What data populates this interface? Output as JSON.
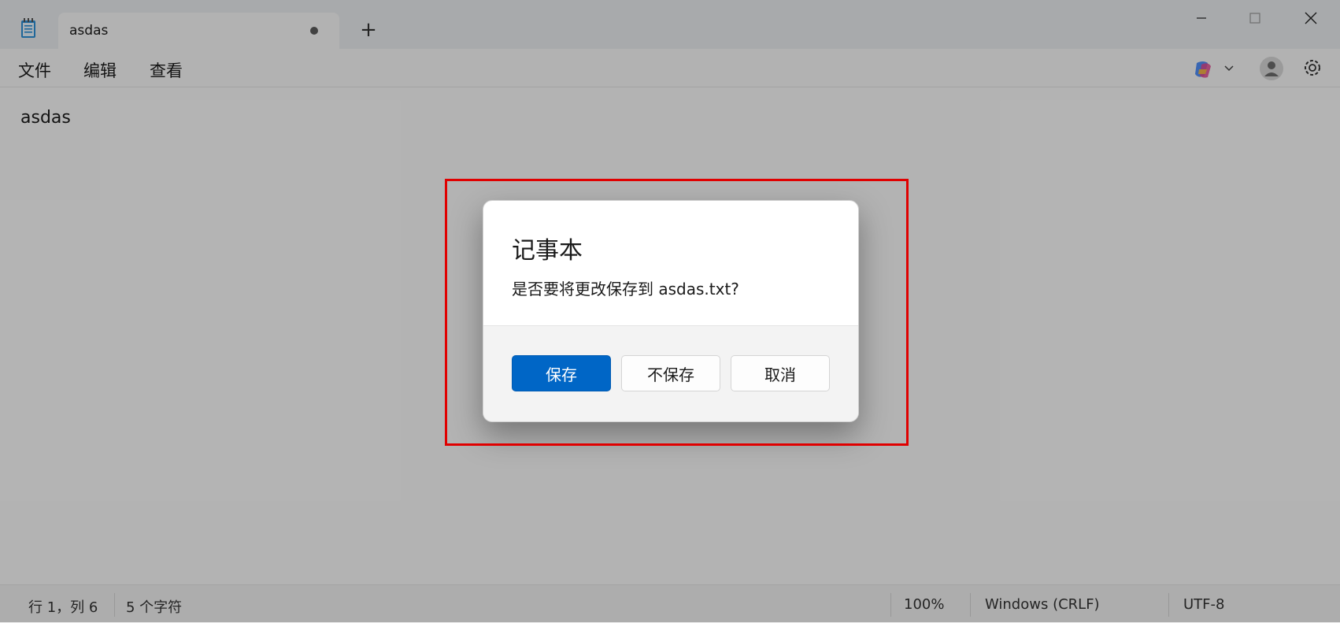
{
  "app": {
    "tab_title": "asdas",
    "new_tab_label": "+"
  },
  "menu": {
    "items": [
      "文件",
      "编辑",
      "查看"
    ]
  },
  "editor": {
    "content": "asdas"
  },
  "status_bar": {
    "position": "行 1，列 6",
    "char_count": "5 个字符",
    "zoom": "100%",
    "line_ending": "Windows (CRLF)",
    "encoding": "UTF-8"
  },
  "dialog": {
    "title": "记事本",
    "message": "是否要将更改保存到 asdas.txt?",
    "buttons": {
      "save": "保存",
      "dont_save": "不保存",
      "cancel": "取消"
    }
  },
  "colors": {
    "accent": "#0066c6",
    "highlight": "#e00000"
  },
  "icons": [
    "notepad-icon",
    "close-icon",
    "minimize-icon",
    "maximize-icon",
    "copilot-icon",
    "chevron-down-icon",
    "account-icon",
    "gear-icon"
  ]
}
